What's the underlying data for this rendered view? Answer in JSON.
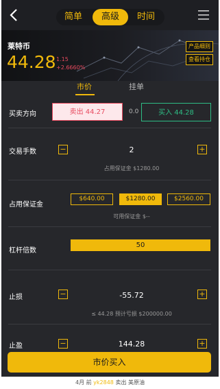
{
  "nav": {
    "modes": [
      "简单",
      "高级",
      "时间"
    ],
    "active_mode": "高级"
  },
  "banner": {
    "name": "莱特币",
    "price": "44.28",
    "change": "1.15",
    "change_pct": "+2.6660%",
    "links": [
      "产品细则",
      "查看持仓"
    ]
  },
  "order_tabs": [
    "市价",
    "挂单"
  ],
  "direction": {
    "label": "买卖方向",
    "sell": "卖出 44.27",
    "spread": "0.0",
    "buy": "买入 44.28"
  },
  "lots": {
    "label": "交易手数",
    "value": "2",
    "note": "占用保证金 $1280.00"
  },
  "margin": {
    "label": "占用保证金",
    "options": [
      "$640.00",
      "$1280.00",
      "$2560.00"
    ],
    "selected": "$1280.00",
    "note": "可用保证金 $--"
  },
  "leverage": {
    "label": "杠杆倍数",
    "value": "50"
  },
  "stop_loss": {
    "label": "止损",
    "value": "-55.72",
    "note": "≤ 44.28 预计亏损 $200000.00"
  },
  "take_profit": {
    "label": "止盈",
    "value": "144.28"
  },
  "submit": "市价买入",
  "ticker": {
    "prefix": "4月 前",
    "user": "yk2848",
    "suffix": "卖出 美原油"
  },
  "colors": {
    "accent": "#f0b90b",
    "sell": "#e84a5f",
    "buy": "#2ebd85",
    "bg": "#26272b"
  }
}
